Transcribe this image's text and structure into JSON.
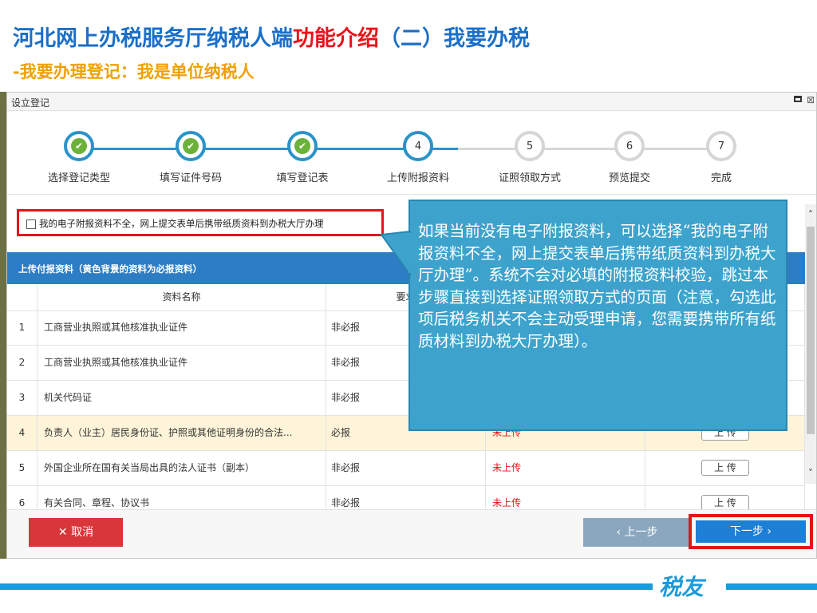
{
  "slide": {
    "title_blue": "河北网上办税服务厅纳税人端",
    "title_red": "功能介绍",
    "title_blue2": "（二）我要办税",
    "subtitle": "-我要办理登记：我是单位纳税人"
  },
  "window": {
    "title": "设立登记",
    "maximize_icon": "window-maximize-icon",
    "close_label": "⊠"
  },
  "steps": [
    {
      "label": "选择登记类型",
      "num": "",
      "state": "done"
    },
    {
      "label": "填写证件号码",
      "num": "",
      "state": "done"
    },
    {
      "label": "填写登记表",
      "num": "",
      "state": "done"
    },
    {
      "label": "上传附报资料",
      "num": "4",
      "state": "active"
    },
    {
      "label": "证照领取方式",
      "num": "5",
      "state": "todo"
    },
    {
      "label": "预览提交",
      "num": "6",
      "state": "todo"
    },
    {
      "label": "完成",
      "num": "7",
      "state": "todo"
    }
  ],
  "checkbox": {
    "label": "我的电子附报资料不全，网上提交表单后携带纸质资料到办税大厅办理"
  },
  "table": {
    "section_title": "上传付报资料（黄色背景的资料为必报资料）",
    "headers": [
      "",
      "资料名称",
      "要求",
      "",
      ""
    ],
    "rows": [
      {
        "no": "1",
        "name": "工商营业执照或其他核准执业证件",
        "req": "非必报",
        "status": "",
        "action": ""
      },
      {
        "no": "2",
        "name": "工商营业执照或其他核准执业证件",
        "req": "非必报",
        "status": "",
        "action": ""
      },
      {
        "no": "3",
        "name": "机关代码证",
        "req": "非必报",
        "status": "",
        "action": ""
      },
      {
        "no": "4",
        "name": "负责人（业主）居民身份证、护照或其他证明身份的合法...",
        "req": "必报",
        "status": "未上传",
        "action": "上 传"
      },
      {
        "no": "5",
        "name": "外国企业所在国有关当局出具的法人证书（副本）",
        "req": "非必报",
        "status": "未上传",
        "action": "上 传"
      },
      {
        "no": "6",
        "name": "有关合同、章程、协议书",
        "req": "非必报",
        "status": "未上传",
        "action": "上 传"
      }
    ]
  },
  "buttons": {
    "cancel": "✕ 取消",
    "prev": "‹ 上一步",
    "next": "下一步 ›"
  },
  "callout": {
    "text": "如果当前没有电子附报资料，可以选择“我的电子附报资料不全，网上提交表单后携带纸质资料到办税大厅办理”。系统不会对必填的附报资料校验，跳过本步骤直接到选择证照领取方式的页面（注意，勾选此项后税务机关不会主动受理申请，您需要携带所有纸质材料到办税大厅办理）。"
  },
  "brand": "税友",
  "colors": {
    "title_blue": "#1b6fc8",
    "title_red": "#e8141a",
    "subtitle_orange": "#f0a000",
    "accent_blue": "#2d7dc5",
    "highlight_red": "#e0161b",
    "callout_bg": "#3da3cc"
  }
}
